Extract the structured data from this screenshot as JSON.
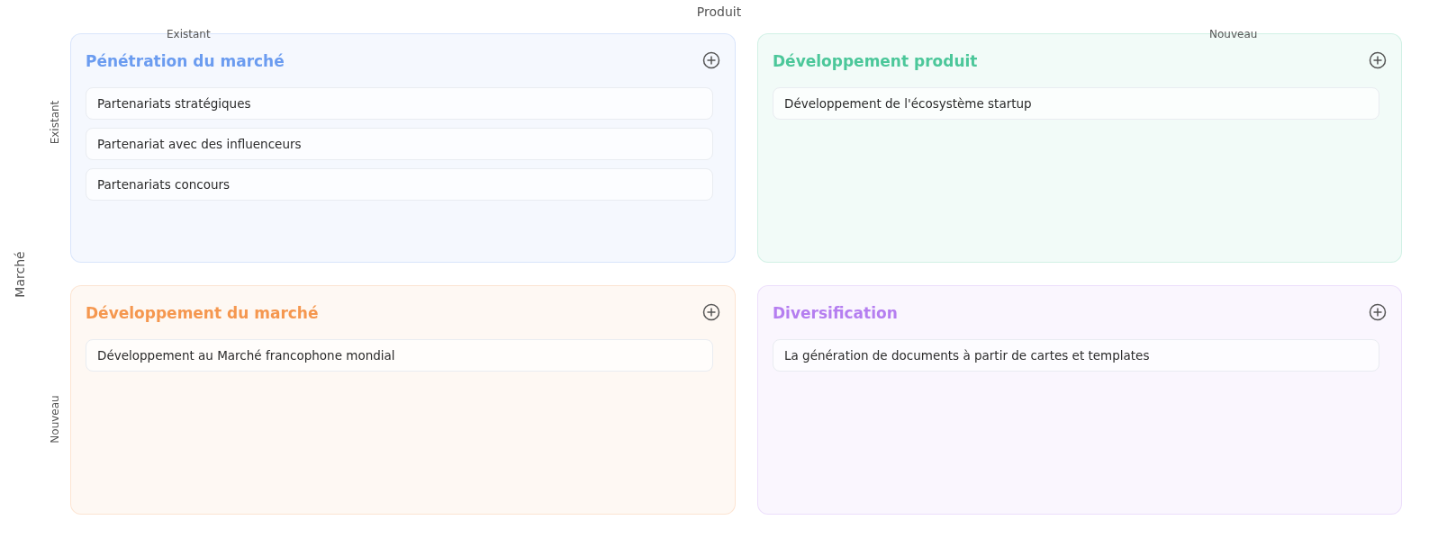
{
  "axis_top": {
    "label": "Produit",
    "left": "Existant",
    "right": "Nouveau"
  },
  "axis_left": {
    "label": "Marché",
    "top": "Existant",
    "bottom": "Nouveau"
  },
  "quadrants": [
    {
      "title": "Pénétration du marché",
      "color": "#6b9cf0",
      "items": [
        "Partenariats stratégiques",
        "Partenariat avec des influenceurs",
        "Partenariats concours"
      ]
    },
    {
      "title": "Développement produit",
      "color": "#4cc79a",
      "items": [
        "Développement de l'écosystème startup"
      ]
    },
    {
      "title": "Développement du marché",
      "color": "#f5974f",
      "items": [
        "Développement au Marché francophone mondial"
      ]
    },
    {
      "title": "Diversification",
      "color": "#b57ef0",
      "items": [
        "La génération de documents à partir de cartes et templates"
      ]
    }
  ]
}
